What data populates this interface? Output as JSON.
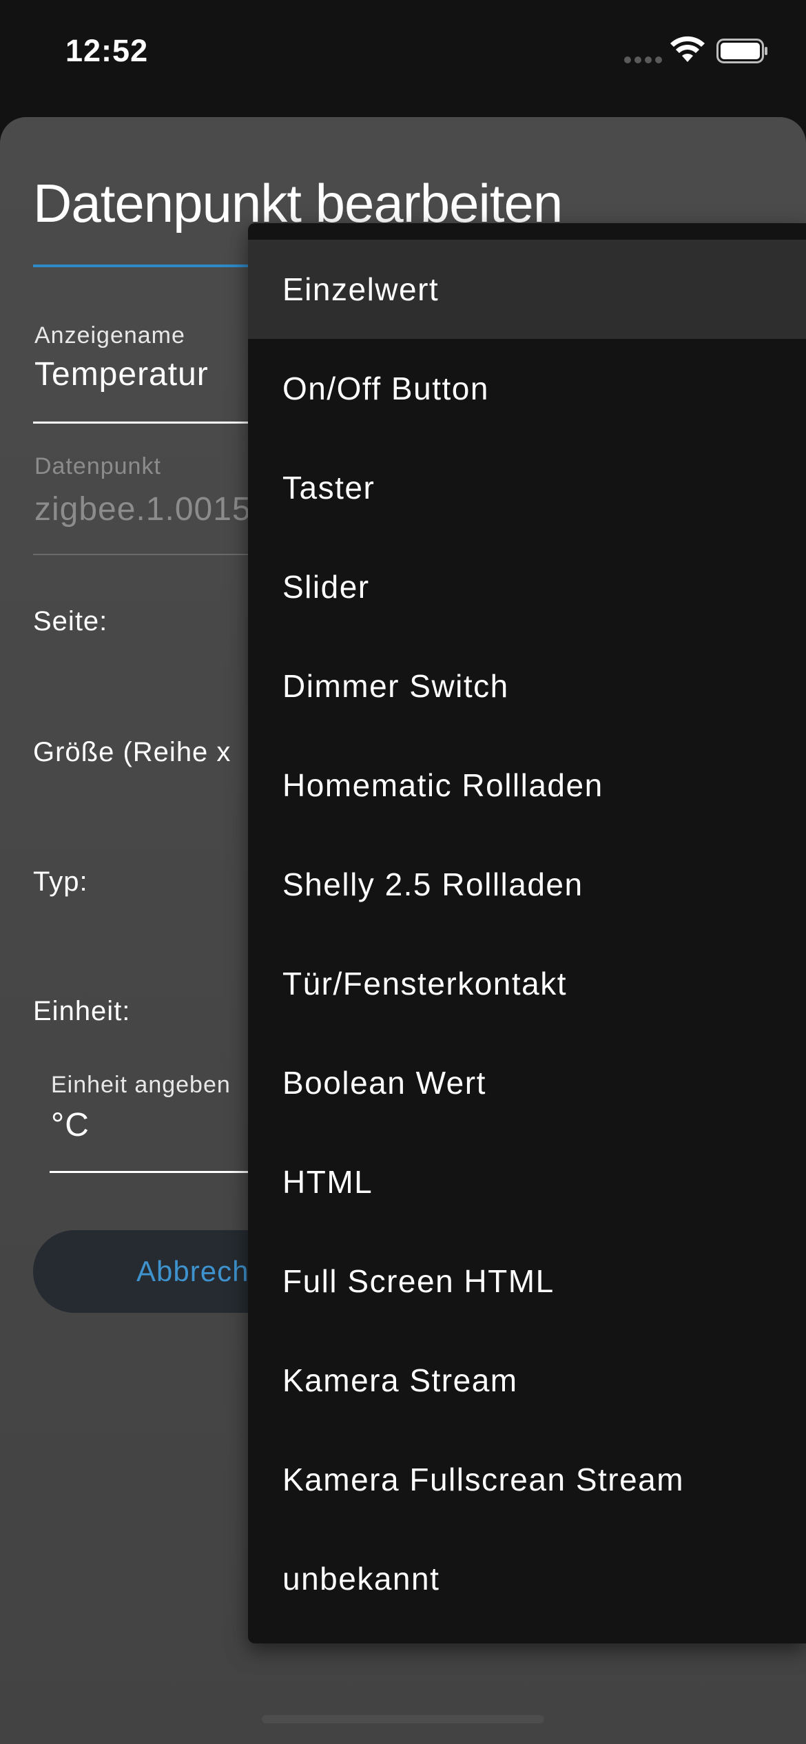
{
  "status_bar": {
    "time": "12:52"
  },
  "dialog": {
    "title": "Datenpunkt bearbeiten",
    "display_name": {
      "label": "Anzeigename",
      "value": "Temperatur"
    },
    "datapoint": {
      "label": "Datenpunkt",
      "value": "zigbee.1.0015"
    },
    "page_label": "Seite:",
    "size_label": "Größe (Reihe x",
    "type_label": "Typ:",
    "unit_label": "Einheit:",
    "unit_field": {
      "label": "Einheit angeben",
      "value": "°C"
    },
    "cancel_label": "Abbrech"
  },
  "type_menu": {
    "selected_index": 0,
    "items": [
      "Einzelwert",
      "On/Off Button",
      "Taster",
      "Slider",
      "Dimmer Switch",
      "Homematic Rollladen",
      "Shelly 2.5 Rollladen",
      "Tür/Fensterkontakt",
      "Boolean Wert",
      "HTML",
      "Full Screen HTML",
      "Kamera Stream",
      "Kamera Fullscrean Stream",
      "unbekannt"
    ]
  },
  "colors": {
    "accent": "#2e89c7",
    "dialog_bg": "#4a4a4a",
    "menu_bg": "#131313",
    "menu_selected_bg": "#2e2e2e",
    "button_text": "#3e93cf"
  },
  "icons": [
    "signal-icon",
    "wifi-icon",
    "battery-icon"
  ]
}
